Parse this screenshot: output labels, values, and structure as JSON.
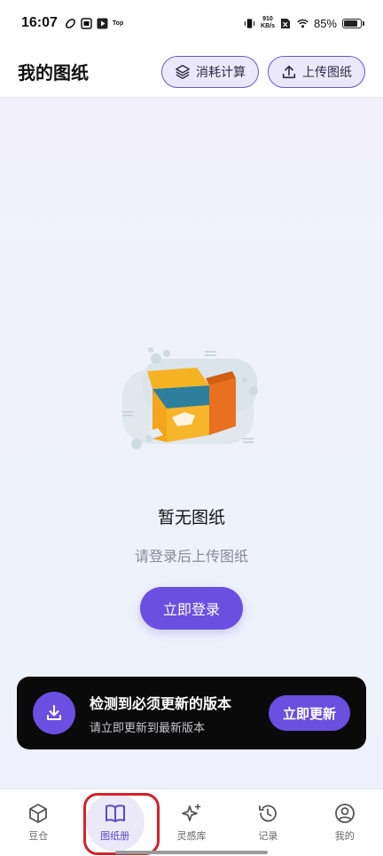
{
  "status_bar": {
    "time": "16:07",
    "top_badge": "Top",
    "net_speed_value": "910",
    "net_speed_unit": "KB/s",
    "battery": "85%"
  },
  "header": {
    "title": "我的图纸",
    "calc_button": "消耗计算",
    "upload_button": "上传图纸"
  },
  "empty_state": {
    "title": "暂无图纸",
    "subtitle": "请登录后上传图纸",
    "login_button": "立即登录"
  },
  "update_banner": {
    "title": "检测到必须更新的版本",
    "subtitle": "请立即更新到最新版本",
    "button": "立即更新"
  },
  "bottom_nav": {
    "items": [
      {
        "label": "豆仓",
        "icon": "cube-icon"
      },
      {
        "label": "图纸册",
        "icon": "book-icon",
        "active": true
      },
      {
        "label": "灵感库",
        "icon": "sparkle-icon"
      },
      {
        "label": "记录",
        "icon": "history-icon"
      },
      {
        "label": "我的",
        "icon": "user-icon"
      }
    ]
  },
  "colors": {
    "accent": "#6a4fe0",
    "banner_bg": "#0a0a0a",
    "highlight": "#d5202a"
  }
}
